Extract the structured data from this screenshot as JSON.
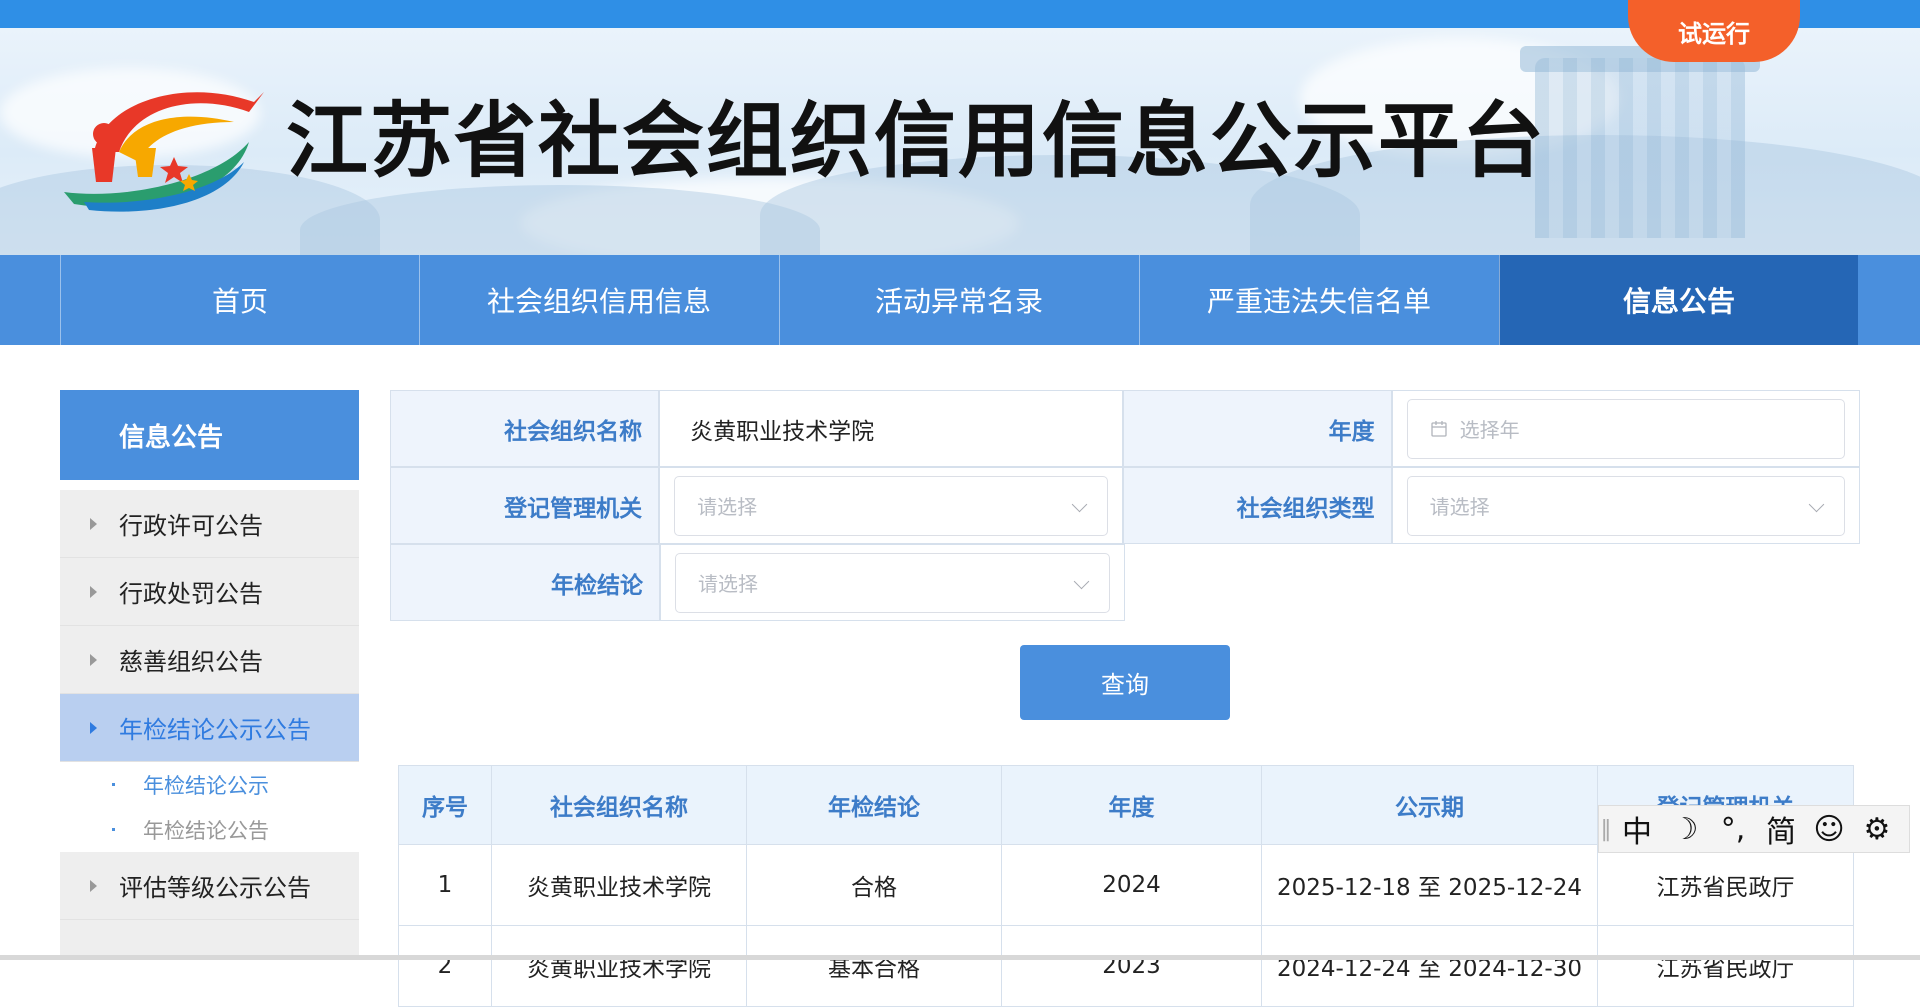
{
  "header": {
    "trial_badge": "试运行",
    "site_title": "江苏省社会组织信用信息公示平台"
  },
  "nav": {
    "items": [
      {
        "label": "首页",
        "active": false
      },
      {
        "label": "社会组织信用信息",
        "active": false
      },
      {
        "label": "活动异常名录",
        "active": false
      },
      {
        "label": "严重违法失信名单",
        "active": false
      },
      {
        "label": "信息公告",
        "active": true
      }
    ]
  },
  "sidebar": {
    "title": "信息公告",
    "items": [
      {
        "label": "行政许可公告"
      },
      {
        "label": "行政处罚公告"
      },
      {
        "label": "慈善组织公告"
      },
      {
        "label": "年检结论公示公告"
      },
      {
        "label": "评估等级公示公告"
      }
    ],
    "sub_items": [
      {
        "label": "年检结论公示"
      },
      {
        "label": "年检结论公告"
      }
    ]
  },
  "search": {
    "org_name_label": "社会组织名称",
    "org_name_value": "炎黄职业技术学院",
    "year_label": "年度",
    "year_placeholder": "选择年",
    "authority_label": "登记管理机关",
    "authority_placeholder": "请选择",
    "org_type_label": "社会组织类型",
    "org_type_placeholder": "请选择",
    "conclusion_label": "年检结论",
    "conclusion_placeholder": "请选择",
    "query_button": "查询"
  },
  "table": {
    "headers": [
      "序号",
      "社会组织名称",
      "年检结论",
      "年度",
      "公示期",
      "登记管理机关"
    ],
    "rows": [
      [
        "1",
        "炎黄职业技术学院",
        "合格",
        "2024",
        "2025-12-18 至 2025-12-24",
        "江苏省民政厅"
      ],
      [
        "2",
        "炎黄职业技术学院",
        "基本合格",
        "2023",
        "2024-12-24 至 2024-12-30",
        "江苏省民政厅"
      ]
    ]
  },
  "ime": {
    "mode": "中",
    "moon": "☽",
    "punct": "°,",
    "script": "简",
    "smile": "☺",
    "gear": "⚙"
  },
  "colors": {
    "nav_blue": "#4a8fdd",
    "nav_active": "#2566b5",
    "badge_orange": "#f4602a",
    "label_blue": "#3d7cc8"
  }
}
